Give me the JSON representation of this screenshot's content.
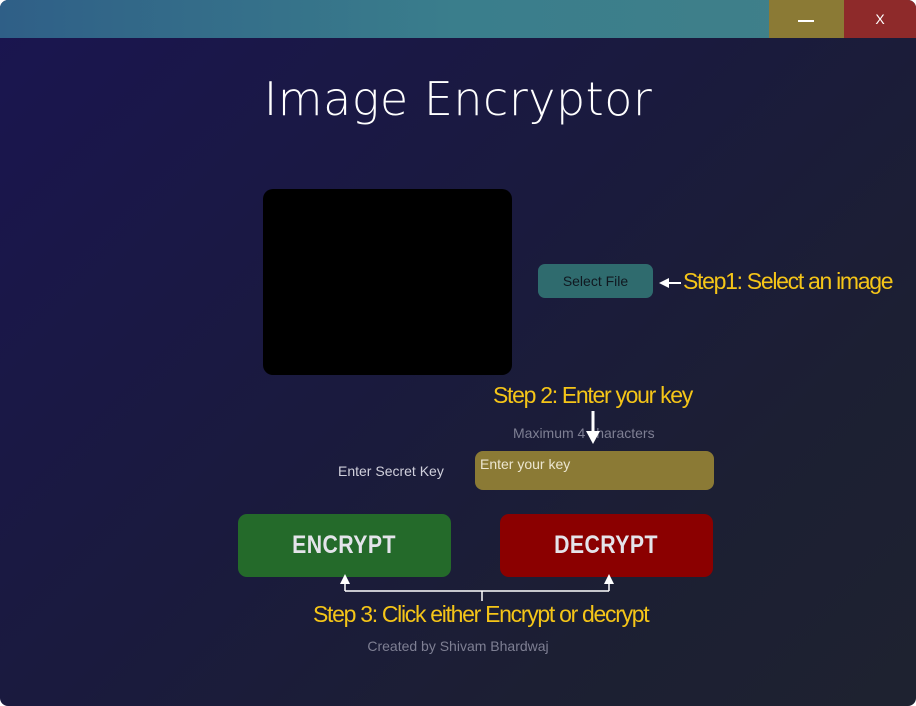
{
  "window": {
    "minimize_label": "—",
    "close_label": "X"
  },
  "app": {
    "title": "Image Encryptor",
    "select_file_label": "Select File",
    "max_chars_text": "Maximum 4 characters",
    "key_label": "Enter Secret Key",
    "key_placeholder": "Enter your key",
    "key_value": "",
    "encrypt_label": "ENCRYPT",
    "decrypt_label": "DECRYPT",
    "credit": "Created by Shivam Bhardwaj"
  },
  "annotations": {
    "step1": "Step1: Select an image",
    "step2": "Step 2: Enter your key",
    "step3": "Step 3: Click either Encrypt or decrypt"
  },
  "colors": {
    "titlebar": "#3a7e8c",
    "minimize_button": "#8b7a35",
    "close_button": "#8e2a2a",
    "select_file_button": "#2f6b6e",
    "key_input": "#8b7a35",
    "encrypt_button": "#246a2a",
    "decrypt_button": "#8b0000",
    "annotation_text": "#f5c518"
  }
}
